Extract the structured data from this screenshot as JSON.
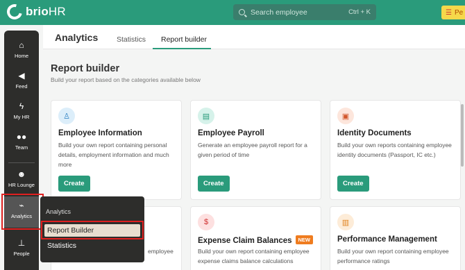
{
  "brand": {
    "name": "brio",
    "suffix": "HR"
  },
  "search": {
    "placeholder": "Search employee",
    "shortcut": "Ctrl + K"
  },
  "user": {
    "label": "Pe"
  },
  "sidebar": {
    "items": [
      {
        "label": "Home",
        "icon": "home-icon"
      },
      {
        "label": "Feed",
        "icon": "megaphone-icon"
      },
      {
        "label": "My HR",
        "icon": "lightning-icon"
      },
      {
        "label": "Team",
        "icon": "team-icon"
      },
      {
        "label": "HR Lounge",
        "icon": "user-gear-icon"
      },
      {
        "label": "Analytics",
        "icon": "chart-icon"
      },
      {
        "label": "People",
        "icon": "org-chart-icon"
      }
    ]
  },
  "flyout": {
    "title": "Analytics",
    "items": [
      "Report Builder",
      "Statistics"
    ]
  },
  "header": {
    "title": "Analytics",
    "tabs": [
      "Statistics",
      "Report builder"
    ]
  },
  "page": {
    "title": "Report builder",
    "subtitle": "Build your report based on the categories available below"
  },
  "cards": [
    {
      "title": "Employee Information",
      "desc": "Build your own report containing personal details, employment information and much more",
      "button": "Create"
    },
    {
      "title": "Employee Payroll",
      "desc": "Generate an employee payroll report for a given period of time",
      "button": "Create"
    },
    {
      "title": "Identity Documents",
      "desc": "Build your own reports containing employee identity documents (Passport, IC etc.)",
      "button": "Create"
    },
    {
      "title": "",
      "desc": "employee"
    },
    {
      "title": "Expense Claim Balances",
      "badge": "NEW",
      "desc": "Build your own report containing employee expense claims balance calculations"
    },
    {
      "title": "Performance Management",
      "desc": "Build your own report containing employee performance ratings"
    }
  ],
  "colors": {
    "accent": "#2a9b7b",
    "highlight": "#e02020",
    "badge": "#ef7c1f"
  }
}
